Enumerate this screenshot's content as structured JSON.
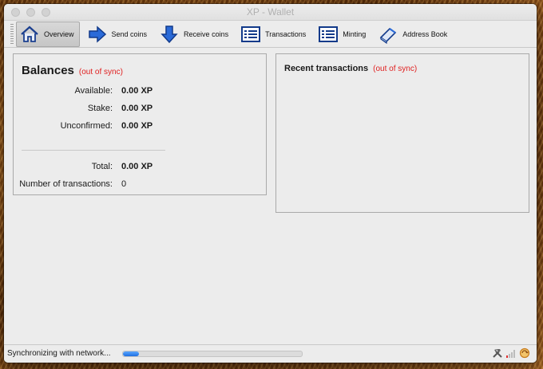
{
  "window": {
    "title": "XP - Wallet"
  },
  "toolbar": {
    "items": [
      {
        "label": "Overview",
        "icon": "home-icon",
        "active": true
      },
      {
        "label": "Send coins",
        "icon": "send-arrow-icon"
      },
      {
        "label": "Receive coins",
        "icon": "receive-arrow-icon"
      },
      {
        "label": "Transactions",
        "icon": "list-icon"
      },
      {
        "label": "Minting",
        "icon": "list-icon"
      },
      {
        "label": "Address Book",
        "icon": "address-book-icon"
      }
    ]
  },
  "balances": {
    "title": "Balances",
    "sync_status": "(out of sync)",
    "available_label": "Available:",
    "available_value": "0.00 XP",
    "stake_label": "Stake:",
    "stake_value": "0.00 XP",
    "unconfirmed_label": "Unconfirmed:",
    "unconfirmed_value": "0.00 XP",
    "total_label": "Total:",
    "total_value": "0.00 XP",
    "num_tx_label": "Number of transactions:",
    "num_tx_value": "0"
  },
  "recent": {
    "title": "Recent transactions",
    "sync_status": "(out of sync)"
  },
  "status": {
    "text": "Synchronizing with network...",
    "progress": 0.09
  },
  "colors": {
    "sync_warning": "#e02020",
    "progress": "#1f6fe0"
  }
}
